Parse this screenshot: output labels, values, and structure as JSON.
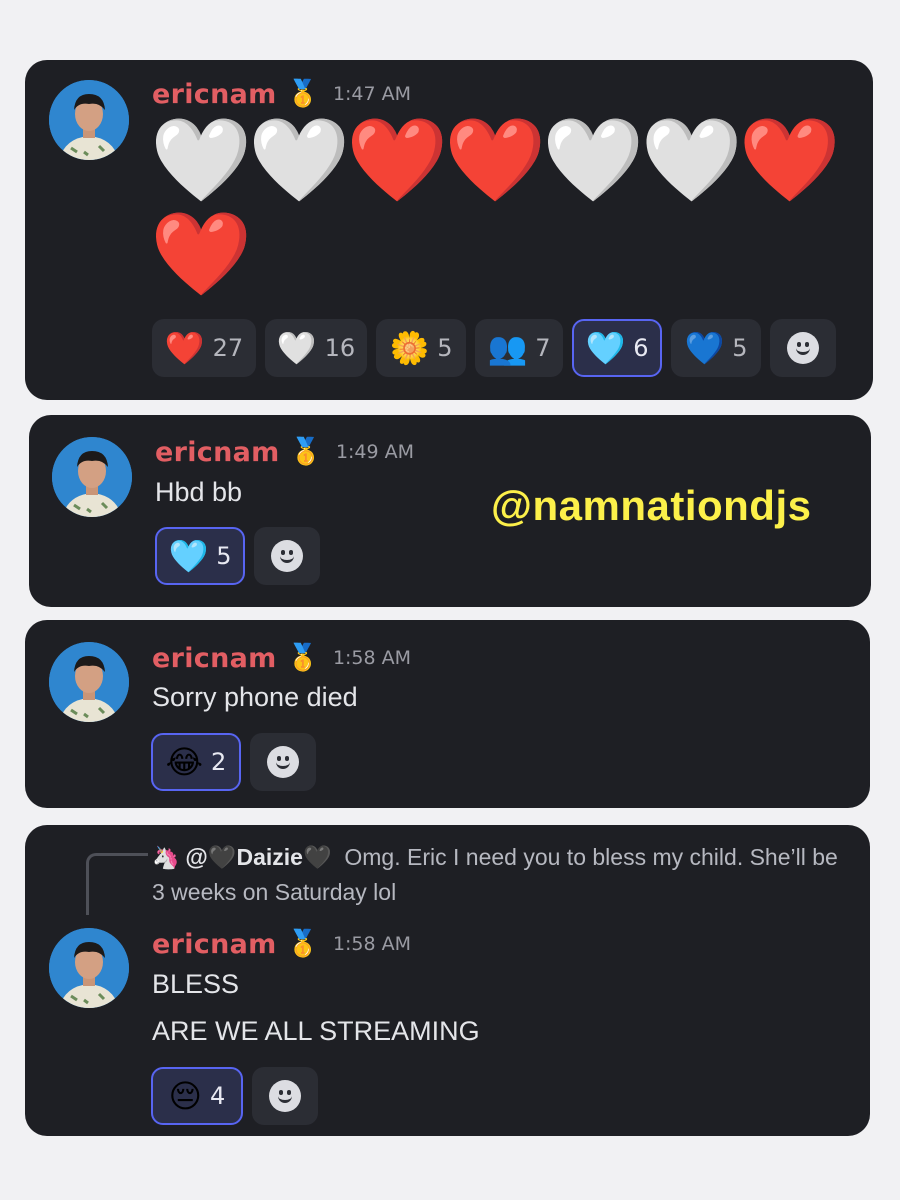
{
  "watermark": "@namnationdjs",
  "messages": [
    {
      "username": "ericnam",
      "badge": "🥇",
      "time": "1:47 AM",
      "hearts_row1": "🤍🤍❤️❤️🤍🤍❤️",
      "hearts_row2": "❤️",
      "reactions": [
        {
          "emoji": "❤️",
          "count": "27",
          "active": false
        },
        {
          "emoji": "🤍",
          "count": "16",
          "active": false
        },
        {
          "emoji": "🌼",
          "count": "5",
          "active": false
        },
        {
          "emoji": "👥",
          "count": "7",
          "active": false
        },
        {
          "emoji": "🩵",
          "count": "6",
          "active": true
        },
        {
          "emoji": "💙",
          "count": "5",
          "active": false
        }
      ]
    },
    {
      "username": "ericnam",
      "badge": "🥇",
      "time": "1:49 AM",
      "text": "Hbd bb",
      "reactions": [
        {
          "emoji": "🩵",
          "count": "5",
          "active": true
        }
      ]
    },
    {
      "username": "ericnam",
      "badge": "🥇",
      "time": "1:58 AM",
      "text": "Sorry phone died",
      "reactions": [
        {
          "emoji": "😂",
          "count": "2",
          "active": true
        }
      ]
    },
    {
      "reply": {
        "icon": "🦄",
        "user": "@🖤Daizie🖤",
        "text": "Omg. Eric I need you to bless my child. She’ll be 3 weeks on Saturday lol"
      },
      "username": "ericnam",
      "badge": "🥇",
      "time": "1:58 AM",
      "line1": "BLESS",
      "line2": "ARE WE ALL STREAMING",
      "reactions": [
        {
          "emoji": "😔",
          "count": "4",
          "active": true
        }
      ]
    }
  ]
}
